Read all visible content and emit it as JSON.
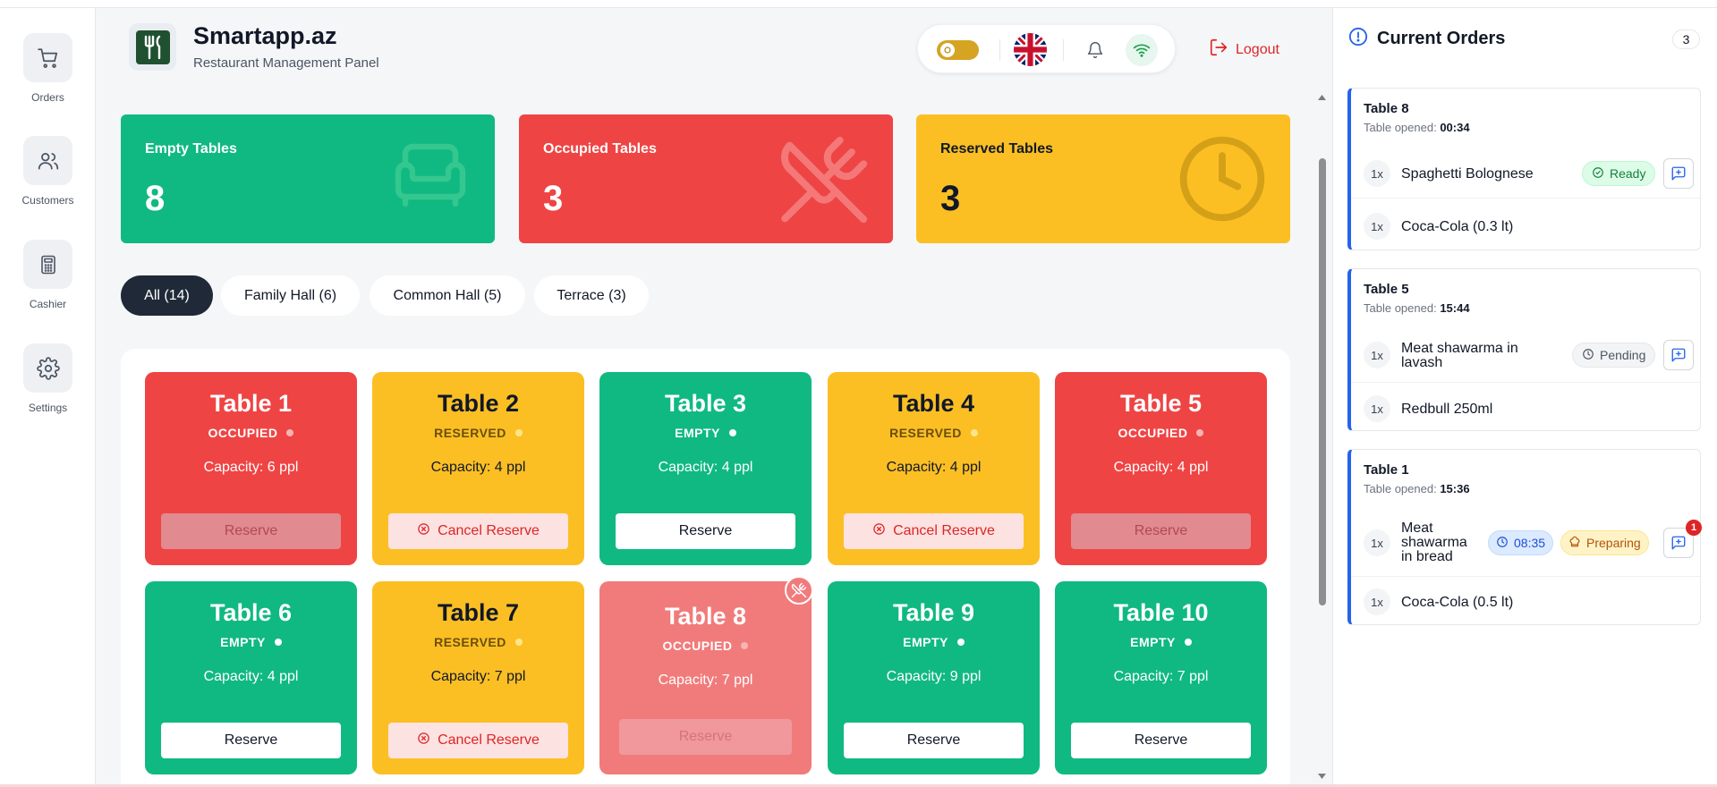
{
  "nav": [
    {
      "label": "Orders",
      "icon": "cart-icon"
    },
    {
      "label": "Customers",
      "icon": "users-icon"
    },
    {
      "label": "Cashier",
      "icon": "calculator-icon"
    },
    {
      "label": "Settings",
      "icon": "gear-icon"
    }
  ],
  "brand": {
    "title": "Smartapp.az",
    "subtitle": "Restaurant Management Panel"
  },
  "header": {
    "logout_label": "Logout"
  },
  "stats": {
    "empty": {
      "label": "Empty Tables",
      "value": "8"
    },
    "occupied": {
      "label": "Occupied Tables",
      "value": "3"
    },
    "reserved": {
      "label": "Reserved Tables",
      "value": "3"
    }
  },
  "filters": [
    "All (14)",
    "Family Hall (6)",
    "Common Hall (5)",
    "Terrace (3)"
  ],
  "tables": [
    {
      "name": "Table 1",
      "status": "OCCUPIED",
      "capacity": "Capacity: 6 ppl",
      "button": "Reserve"
    },
    {
      "name": "Table 2",
      "status": "RESERVED",
      "capacity": "Capacity: 4 ppl",
      "button": "Cancel Reserve"
    },
    {
      "name": "Table 3",
      "status": "EMPTY",
      "capacity": "Capacity: 4 ppl",
      "button": "Reserve"
    },
    {
      "name": "Table 4",
      "status": "RESERVED",
      "capacity": "Capacity: 4 ppl",
      "button": "Cancel Reserve"
    },
    {
      "name": "Table 5",
      "status": "OCCUPIED",
      "capacity": "Capacity: 4 ppl",
      "button": "Reserve"
    },
    {
      "name": "Table 6",
      "status": "EMPTY",
      "capacity": "Capacity: 4 ppl",
      "button": "Reserve"
    },
    {
      "name": "Table 7",
      "status": "RESERVED",
      "capacity": "Capacity: 7 ppl",
      "button": "Cancel Reserve"
    },
    {
      "name": "Table 8",
      "status": "OCCUPIED",
      "capacity": "Capacity: 7 ppl",
      "button": "Reserve"
    },
    {
      "name": "Table 9",
      "status": "EMPTY",
      "capacity": "Capacity: 9 ppl",
      "button": "Reserve"
    },
    {
      "name": "Table 10",
      "status": "EMPTY",
      "capacity": "Capacity: 7 ppl",
      "button": "Reserve"
    }
  ],
  "orders_panel": {
    "title": "Current Orders",
    "count": "3",
    "orders": [
      {
        "table": "Table 8",
        "opened_label": "Table opened:",
        "opened_time": "00:34",
        "items": [
          {
            "qty": "1x",
            "name": "Spaghetti Bolognese",
            "status": "Ready"
          },
          {
            "qty": "1x",
            "name": "Coca-Cola (0.3 lt)"
          }
        ]
      },
      {
        "table": "Table 5",
        "opened_label": "Table opened:",
        "opened_time": "15:44",
        "items": [
          {
            "qty": "1x",
            "name_line1": "Meat shawarma in",
            "name_line2": "lavash",
            "status": "Pending"
          },
          {
            "qty": "1x",
            "name": "Redbull 250ml"
          }
        ]
      },
      {
        "table": "Table 1",
        "opened_label": "Table opened:",
        "opened_time": "15:36",
        "items": [
          {
            "qty": "1x",
            "name_line1": "Meat",
            "name_line2": "shawarma",
            "name_line3": "in bread",
            "timer": "08:35",
            "status": "Preparing",
            "notification": "1"
          },
          {
            "qty": "1x",
            "name": "Coca-Cola (0.5 lt)"
          }
        ]
      }
    ]
  },
  "colors": {
    "empty": "#10b981",
    "occupied": "#ef4444",
    "reserved": "#fbbf24",
    "accent": "#2563eb",
    "logout": "#dc2626"
  }
}
